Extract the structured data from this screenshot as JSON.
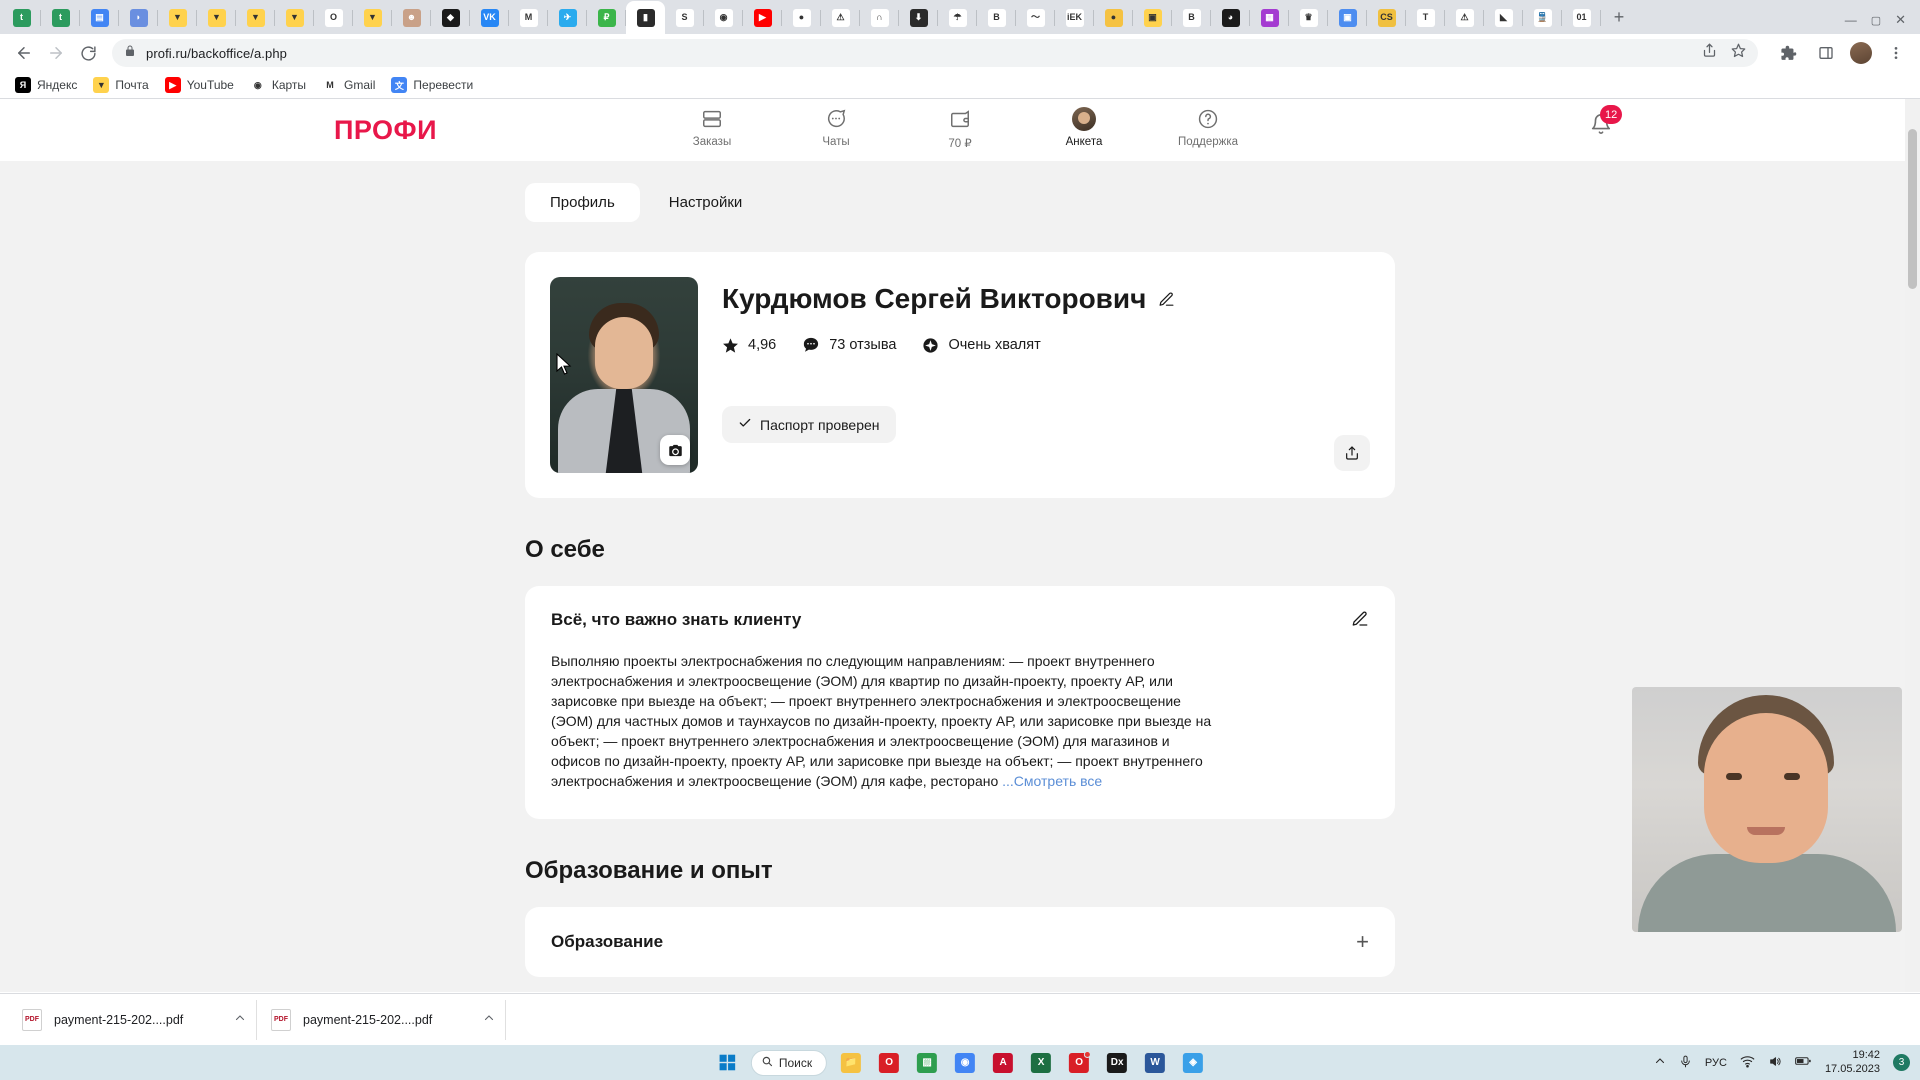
{
  "browser": {
    "url": "profi.ru/backoffice/a.php",
    "lock_icon": "lock-icon",
    "back_icon": "back-arrow-icon",
    "forward_icon": "forward-arrow-icon",
    "reload_icon": "reload-icon",
    "share_icon": "share-icon",
    "star_icon": "star-bookmark-icon",
    "extensions_icon": "puzzle-extensions-icon",
    "sidepanel_icon": "side-panel-icon",
    "menu_icon": "three-dot-menu-icon",
    "newtab_label": "+",
    "minimize_label": "—",
    "maximize_label": "▢",
    "tabs": [
      {
        "name": "telegram-green-tab",
        "glyph": "t",
        "bg": "#2c9b5e",
        "active": false
      },
      {
        "name": "telegram-green-tab-2",
        "glyph": "t",
        "bg": "#2c9b5e",
        "active": false
      },
      {
        "name": "google-docs-tab",
        "glyph": "▤",
        "bg": "#4285f4",
        "active": false
      },
      {
        "name": "blue-capsule-tab",
        "glyph": "◗",
        "bg": "#6a8fe0",
        "active": false
      },
      {
        "name": "mail-ru-tab",
        "glyph": "▼",
        "bg": "#ffd24d",
        "active": false
      },
      {
        "name": "mail-ru-tab-2",
        "glyph": "▼",
        "bg": "#ffd24d",
        "active": false
      },
      {
        "name": "mail-ru-tab-3",
        "glyph": "▼",
        "bg": "#ffd24d",
        "active": false
      },
      {
        "name": "mail-ru-tab-4",
        "glyph": "▼",
        "bg": "#ffd24d",
        "active": false
      },
      {
        "name": "opera-tab",
        "glyph": "O",
        "bg": "#ffffff",
        "active": false
      },
      {
        "name": "mail-ru-tab-5",
        "glyph": "▼",
        "bg": "#ffd24d",
        "active": false
      },
      {
        "name": "avatar-person-tab",
        "glyph": "☻",
        "bg": "#c9a188",
        "active": false
      },
      {
        "name": "diamond-black-tab",
        "glyph": "◆",
        "bg": "#1a1a1a",
        "active": false
      },
      {
        "name": "vk-tab",
        "glyph": "VK",
        "bg": "#2787f5",
        "active": false
      },
      {
        "name": "gmail-tab",
        "glyph": "M",
        "bg": "#ffffff",
        "active": false
      },
      {
        "name": "telegram-tab",
        "glyph": "✈",
        "bg": "#2aabee",
        "active": false
      },
      {
        "name": "money-green-tab",
        "glyph": "₽",
        "bg": "#3bb54a",
        "active": false
      },
      {
        "name": "contact-card-tab",
        "glyph": "▮",
        "bg": "#2b2b2b",
        "active": true
      },
      {
        "name": "sberbank-tab",
        "glyph": "S",
        "bg": "#ffffff",
        "active": false
      },
      {
        "name": "antenna-tab",
        "glyph": "◉",
        "bg": "#ffffff",
        "active": false
      },
      {
        "name": "youtube-tab",
        "glyph": "▶",
        "bg": "#ff0000",
        "active": false
      },
      {
        "name": "colored-circles-tab",
        "glyph": "●",
        "bg": "#ffffff",
        "active": false
      },
      {
        "name": "warning-triangle-tab",
        "glyph": "⚠",
        "bg": "#ffffff",
        "active": false
      },
      {
        "name": "orange-people-tab",
        "glyph": "∩",
        "bg": "#ffffff",
        "active": false
      },
      {
        "name": "download-circle-tab",
        "glyph": "⬇",
        "bg": "#2b2b2b",
        "active": false
      },
      {
        "name": "umbrella-tab",
        "glyph": "☂",
        "bg": "#ffffff",
        "active": false
      },
      {
        "name": "bbo-blog-tab",
        "glyph": "B",
        "bg": "#ffffff",
        "active": false
      },
      {
        "name": "chart-line-tab",
        "glyph": "〜",
        "bg": "#ffffff",
        "active": false
      },
      {
        "name": "iek-tab",
        "glyph": "iEK",
        "bg": "#ffffff",
        "active": false
      },
      {
        "name": "yellow-circle-tab",
        "glyph": "●",
        "bg": "#f5c242",
        "active": false
      },
      {
        "name": "image-photo-tab",
        "glyph": "▣",
        "bg": "#ffd24d",
        "active": false
      },
      {
        "name": "bbo-blog-tab-2",
        "glyph": "B",
        "bg": "#ffffff",
        "active": false
      },
      {
        "name": "dark-circle-tab",
        "glyph": "◕",
        "bg": "#1b1b1b",
        "active": false
      },
      {
        "name": "calculator-purple-tab",
        "glyph": "▦",
        "bg": "#a43bd1",
        "active": false
      },
      {
        "name": "eagle-emblem-tab",
        "glyph": "♛",
        "bg": "#ffffff",
        "active": false
      },
      {
        "name": "blue-box-tab",
        "glyph": "▣",
        "bg": "#4d8df0",
        "active": false
      },
      {
        "name": "cs-yellow-tab",
        "glyph": "CS",
        "bg": "#f0c040",
        "active": false
      },
      {
        "name": "tinkoff-tab",
        "glyph": "T",
        "bg": "#ffffff",
        "active": false
      },
      {
        "name": "warning-triangle-tab-2",
        "glyph": "⚠",
        "bg": "#ffffff",
        "active": false
      },
      {
        "name": "blue-origami-tab",
        "glyph": "◣",
        "bg": "#ffffff",
        "active": false
      },
      {
        "name": "train-red-tab",
        "glyph": "🚆",
        "bg": "#ffffff",
        "active": false
      },
      {
        "name": "zero-one-tab",
        "glyph": "01",
        "bg": "#ffffff",
        "active": false
      }
    ],
    "bookmarks": [
      {
        "label": "Яндекс",
        "icon": "yandex-icon",
        "bg": "#000000",
        "glyph": "Я"
      },
      {
        "label": "Почта",
        "icon": "mail-icon",
        "bg": "#ffd24d",
        "glyph": "▼"
      },
      {
        "label": "YouTube",
        "icon": "youtube-icon",
        "bg": "#ff0000",
        "glyph": "▶"
      },
      {
        "label": "Карты",
        "icon": "maps-icon",
        "bg": "#ffffff",
        "glyph": "◉"
      },
      {
        "label": "Gmail",
        "icon": "gmail-icon",
        "bg": "#ffffff",
        "glyph": "M"
      },
      {
        "label": "Перевести",
        "icon": "translate-icon",
        "bg": "#4285f4",
        "glyph": "文"
      }
    ]
  },
  "site": {
    "logo": "ПРОФИ",
    "nav": [
      {
        "label": "Заказы",
        "icon": "orders-icon",
        "active": false
      },
      {
        "label": "Чаты",
        "icon": "chat-bubble-icon",
        "active": false
      },
      {
        "label": "70 ₽",
        "icon": "wallet-icon",
        "active": false
      },
      {
        "label": "Анкета",
        "icon": "profile-avatar-icon",
        "active": true
      },
      {
        "label": "Поддержка",
        "icon": "question-circle-icon",
        "active": false
      }
    ],
    "notifications": {
      "icon": "bell-icon",
      "count": "12"
    }
  },
  "page_tabs": [
    {
      "label": "Профиль",
      "active": true
    },
    {
      "label": "Настройки",
      "active": false
    }
  ],
  "profile": {
    "name": "Курдюмов Сергей Викторович",
    "edit_icon": "pencil-edit-icon",
    "photo_icon": "camera-icon",
    "share_icon": "share-export-icon",
    "stats": [
      {
        "icon": "star-icon",
        "value": "4,96"
      },
      {
        "icon": "reviews-bubble-icon",
        "value": "73 отзыва"
      },
      {
        "icon": "praise-badge-icon",
        "value": "Очень хвалят"
      }
    ],
    "passport": {
      "icon": "check-icon",
      "label": "Паспорт проверен"
    }
  },
  "about_section": {
    "title": "О себе",
    "card_title": "Всё, что важно знать клиенту",
    "edit_icon": "pencil-edit-icon",
    "text": "Выполняю проекты электроснабжения по следующим направлениям: — проект внутреннего электроснабжения и электроосвещение (ЭОМ) для квартир по дизайн-проекту, проекту АР, или зарисовке при выезде на объект; — проект внутреннего электроснабжения и электроосвещение (ЭОМ) для частных домов и таунхаусов по дизайн-проекту, проекту АР, или зарисовке при выезде на объект; — проект внутреннего электроснабжения и электроосвещение (ЭОМ) для магазинов и офисов по дизайн-проекту, проекту АР, или зарисовке при выезде на объект; — проект внутреннего электроснабжения и электроосвещение (ЭОМ) для кафе, ресторано ",
    "more_link": "...Смотреть все"
  },
  "education_section": {
    "title": "Образование и опыт",
    "card_title": "Образование",
    "expand_icon": "plus-icon"
  },
  "downloads": [
    {
      "name": "payment-215-202....pdf",
      "icon": "pdf-file-icon",
      "caret": "caret-up-icon"
    },
    {
      "name": "payment-215-202....pdf",
      "icon": "pdf-file-icon",
      "caret": "caret-up-icon"
    }
  ],
  "taskbar": {
    "start_icon": "windows-start-icon",
    "search_label": "Поиск",
    "search_icon": "search-icon",
    "apps": [
      {
        "name": "file-explorer-icon",
        "glyph": "📁",
        "bg": "#f5c242"
      },
      {
        "name": "opera-icon",
        "glyph": "O",
        "bg": "#d91f26"
      },
      {
        "name": "xbox-green-icon",
        "glyph": "▨",
        "bg": "#2e9e4f"
      },
      {
        "name": "chrome-icon",
        "glyph": "◉",
        "bg": "#4285f4"
      },
      {
        "name": "autocad-icon",
        "glyph": "A",
        "bg": "#c8102e"
      },
      {
        "name": "excel-icon",
        "glyph": "X",
        "bg": "#1d6f42"
      },
      {
        "name": "opera-gx-icon",
        "glyph": "O",
        "bg": "#d91f26",
        "dot": true
      },
      {
        "name": "dropbox-icon",
        "glyph": "Dx",
        "bg": "#1a1a1a"
      },
      {
        "name": "word-icon",
        "glyph": "W",
        "bg": "#2b579a"
      },
      {
        "name": "blue-app-icon",
        "glyph": "◈",
        "bg": "#3aa0e8"
      }
    ],
    "tray": {
      "chevron_icon": "chevron-up-icon",
      "mic_icon": "microphone-icon",
      "language": "РУС",
      "wifi_icon": "wifi-icon",
      "volume_icon": "speaker-icon",
      "battery_icon": "battery-icon",
      "time": "19:42",
      "date": "17.05.2023",
      "notification_count": "3"
    }
  },
  "colors": {
    "brand": "#e8174a",
    "link": "#5b8ed6",
    "page_bg": "#f2f2f2",
    "taskbar_bg": "#d7e6ec"
  }
}
